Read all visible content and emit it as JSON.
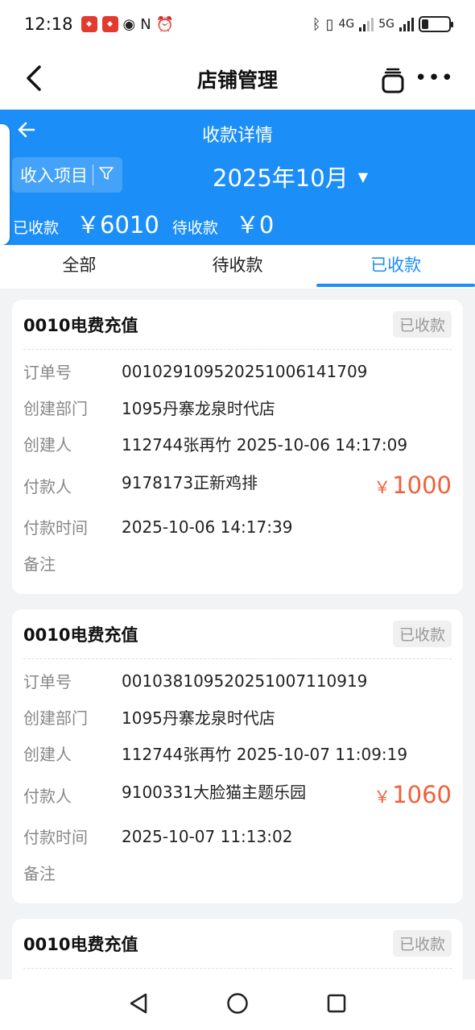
{
  "status_bar": {
    "time": "12:18",
    "network_1": "4G",
    "network_2": "5G",
    "battery_level": 0.25
  },
  "app_bar": {
    "title": "店铺管理",
    "back_icon": "chevron-left-icon",
    "cube_icon": "cube-icon",
    "more_icon": "more-horizontal-icon"
  },
  "header": {
    "title": "收款详情",
    "filter_label": "收入项目",
    "month": "2025年10月",
    "received_label": "已收款",
    "received_amount": "￥6010",
    "pending_label": "待收款",
    "pending_amount": "￥0"
  },
  "tabs": [
    {
      "label": "全部",
      "active": false
    },
    {
      "label": "待收款",
      "active": false
    },
    {
      "label": "已收款",
      "active": true
    }
  ],
  "labels": {
    "order_no": "订单号",
    "dept": "创建部门",
    "creator": "创建人",
    "payer": "付款人",
    "pay_time": "付款时间",
    "remark": "备注"
  },
  "records": [
    {
      "name": "0010电费充值",
      "status": "已收款",
      "order_no": "00102910952025100614​1709",
      "dept": "1095丹寨龙泉时代店",
      "creator": "112744张再竹  2025-10-06 14:17:09",
      "payer": "9178173正新鸡排",
      "currency": "￥",
      "amount": "1000",
      "pay_time": "2025-10-06 14:17:39",
      "remark": ""
    },
    {
      "name": "0010电费充值",
      "status": "已收款",
      "order_no": "001038109520251007110919",
      "dept": "1095丹寨龙泉时代店",
      "creator": "112744张再竹  2025-10-07 11:09:19",
      "payer": "9100331大脸猫主题乐园",
      "currency": "￥",
      "amount": "1060",
      "pay_time": "2025-10-07 11:13:02",
      "remark": ""
    },
    {
      "name": "0010电费充值",
      "status": "已收款"
    }
  ],
  "colors": {
    "accent": "#1c8ef7",
    "price": "#f0603a"
  }
}
